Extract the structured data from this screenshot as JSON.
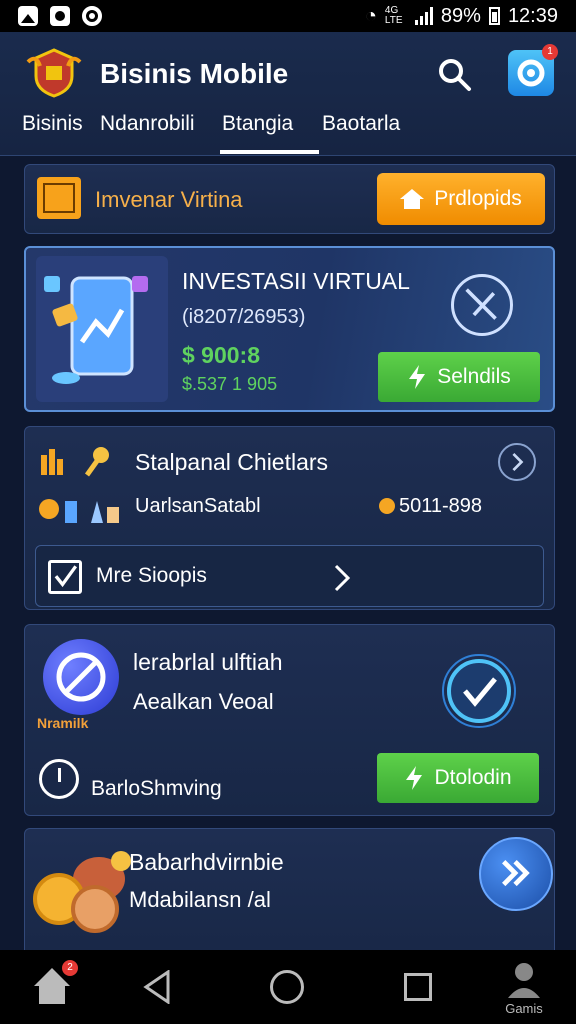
{
  "status_bar": {
    "battery": "89%",
    "time": "12:39",
    "network_small": "4G LTE"
  },
  "app_bar": {
    "title": "Bisinis Mobile",
    "notification_count": "1"
  },
  "tabs": [
    {
      "label": "Bisinis"
    },
    {
      "label": "Ndanrobili"
    },
    {
      "label": "Btangia"
    },
    {
      "label": "Baotarla"
    }
  ],
  "selected_tab": "Btangia",
  "card_invest_header": {
    "label": "Imvenar Virtina",
    "button_label": "Prdlopids"
  },
  "card_invest": {
    "title": "INVESTASII VIRTUAL",
    "subtitle": "(i8207/26953)",
    "value": "$ 900:8",
    "value_secondary": "$.537 1 905",
    "button_label": "Selndils"
  },
  "card_stats": {
    "title": "Stalpanal Chietlars",
    "row_label": "UarlsanSatabl",
    "row_value": "5011-898",
    "inner_label": "Mre Sioopis"
  },
  "card_promo": {
    "title": "lerabrlal ulftiah",
    "subtitle": "Aealkan Veoal",
    "logo_text": "Nramilk",
    "footer_label": "BarloShmving",
    "button_label": "Dtolodin"
  },
  "card_bottom": {
    "title": "Babarhdvirnbie",
    "subtitle": "Mdabilansn /al"
  },
  "nav_bar": {
    "home_badge": "2",
    "games_label": "Gamis"
  },
  "colors": {
    "accent_orange": "#f7a21b",
    "accent_green": "#4cbf3d",
    "background": "#0e1830",
    "card": "#1e2e52"
  }
}
